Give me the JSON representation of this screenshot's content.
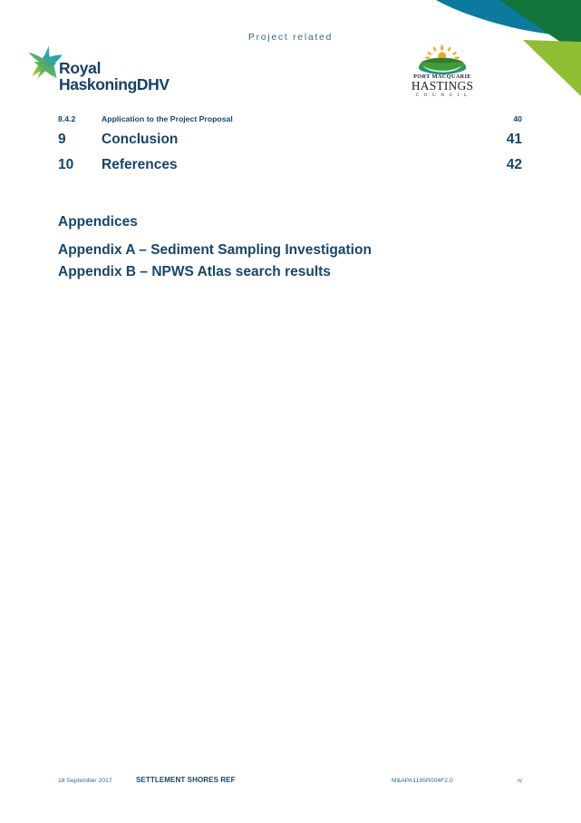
{
  "document": {
    "running_header": "Project related",
    "page_number": "iv"
  },
  "brand": {
    "primary_logo": {
      "icon": "rhdhv-star-icon",
      "line1": "Royal",
      "line2": "HaskoningDHV"
    },
    "client_logo": {
      "icon": "council-sun-hills-icon",
      "line1": "PORT MACQUARIE",
      "line2": "HASTINGS",
      "line3": "C O U N C I L"
    }
  },
  "colors": {
    "heading_blue": "#17466b",
    "accent_blue": "#2e6d8e",
    "deco_teal": "#0b7a9e",
    "deco_dark_green": "#13743a",
    "deco_light_green": "#8fbe33",
    "logo_navy": "#15406a",
    "council_sun": "#f5a81c",
    "council_green": "#3f9c35",
    "council_water": "#0d8bbd"
  },
  "toc": {
    "entries": [
      {
        "number": "8.4.2",
        "title": "Application to the Project Proposal",
        "page": "40",
        "level": 3
      },
      {
        "number": "9",
        "title": "Conclusion",
        "page": "41",
        "level": 1
      },
      {
        "number": "10",
        "title": "References",
        "page": "42",
        "level": 1
      }
    ]
  },
  "appendices": {
    "heading": "Appendices",
    "items": [
      {
        "label": "Appendix A – Sediment Sampling Investigation"
      },
      {
        "label": "Appendix B – NPWS Atlas search results"
      }
    ]
  },
  "footer": {
    "date": "18 September 2017",
    "title": "SETTLEMENT SHORES REF",
    "reference": "M&APA1195R004F2.0",
    "page": "iv"
  }
}
